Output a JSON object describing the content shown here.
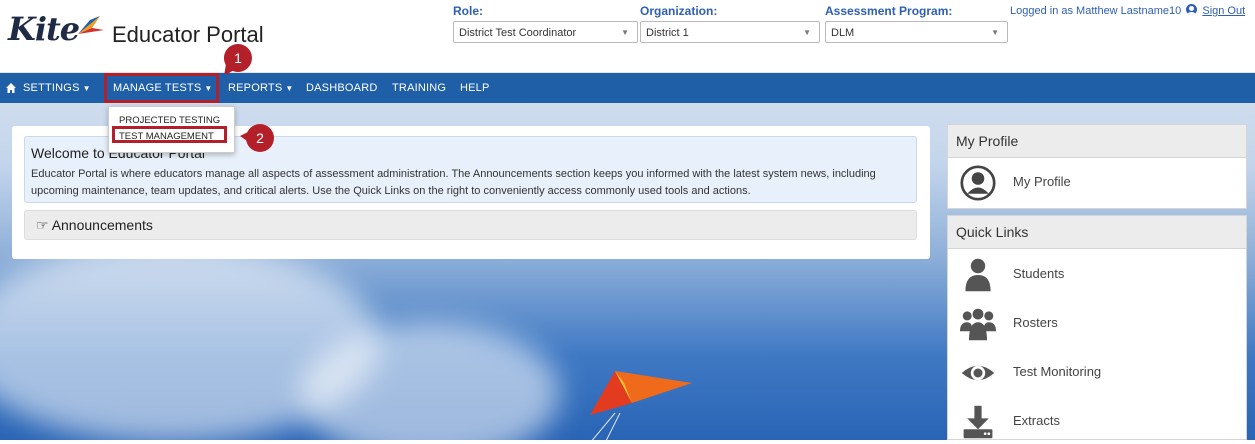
{
  "header": {
    "logo_text": "Kite",
    "app_title": "Educator Portal",
    "role": {
      "label": "Role:",
      "value": "District Test Coordinator"
    },
    "organization": {
      "label": "Organization:",
      "value": "District 1"
    },
    "program": {
      "label": "Assessment Program:",
      "value": "DLM"
    },
    "logged_in_text": "Logged in as Matthew Lastname10",
    "sign_out": "Sign Out"
  },
  "nav": {
    "items": [
      {
        "label": "SETTINGS",
        "caret": "▼"
      },
      {
        "label": "MANAGE TESTS",
        "caret": "▼"
      },
      {
        "label": "REPORTS",
        "caret": "▼"
      },
      {
        "label": "DASHBOARD"
      },
      {
        "label": "TRAINING"
      },
      {
        "label": "HELP"
      }
    ]
  },
  "dropdown": {
    "items": [
      "PROJECTED TESTING",
      "TEST MANAGEMENT"
    ]
  },
  "callouts": [
    "1",
    "2"
  ],
  "welcome": {
    "title": "Welcome to Educator Portal",
    "text": "Educator Portal is where educators manage all aspects of assessment administration. The Announcements section keeps you informed with the latest system news, including upcoming maintenance, team updates, and critical alerts. Use the Quick Links on the right to conveniently access commonly used tools and actions."
  },
  "announcements": {
    "label": "Announcements"
  },
  "profile": {
    "title": "My Profile",
    "link": "My Profile"
  },
  "quick_links": {
    "title": "Quick Links",
    "items": [
      "Students",
      "Rosters",
      "Test Monitoring",
      "Extracts"
    ]
  },
  "colors": {
    "nav": "#1f5fa8",
    "accent": "#2f5fb3",
    "callout": "#b3202a"
  }
}
